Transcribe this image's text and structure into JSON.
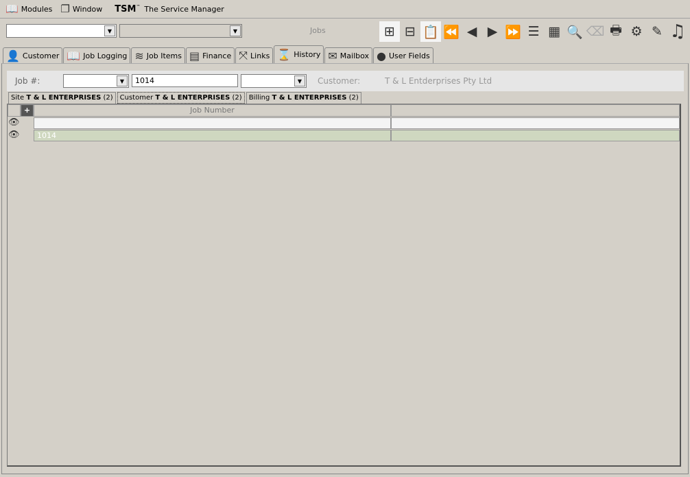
{
  "menubar": {
    "modules": "Modules",
    "window": "Window",
    "brand": "TSM",
    "trademark": "™",
    "app_title": "The Service Manager"
  },
  "toolbar": {
    "context_label": "Jobs",
    "icons": [
      "add-icon",
      "remove-icon",
      "copy-icon",
      "first-icon",
      "previous-icon",
      "next-icon",
      "last-icon",
      "list-icon",
      "grid-icon",
      "zoom-icon",
      "eraser-icon",
      "print-icon",
      "settings-icon",
      "edit-icon",
      "music-icon"
    ]
  },
  "tabs": [
    {
      "label": "Customer"
    },
    {
      "label": "Job Logging"
    },
    {
      "label": "Job Items"
    },
    {
      "label": "Finance"
    },
    {
      "label": "Links"
    },
    {
      "label": "History",
      "active": true
    },
    {
      "label": "Mailbox"
    },
    {
      "label": "User Fields"
    }
  ],
  "filter": {
    "job_label": "Job #:",
    "job_value": "1014",
    "customer_label": "Customer:",
    "customer_value": "T & L Entderprises Pty Ltd"
  },
  "subtabs": [
    {
      "prefix": "Site",
      "name": "T & L ENTERPRISES",
      "count": "(2)"
    },
    {
      "prefix": "Customer",
      "name": "T & L ENTERPRISES",
      "count": "(2)",
      "active": true
    },
    {
      "prefix": "Billing",
      "name": "T & L ENTERPRISES",
      "count": "(2)"
    }
  ],
  "grid": {
    "columns": [
      "Job Number",
      ""
    ],
    "rows": [
      [
        "",
        ""
      ],
      [
        "1014",
        ""
      ]
    ]
  }
}
